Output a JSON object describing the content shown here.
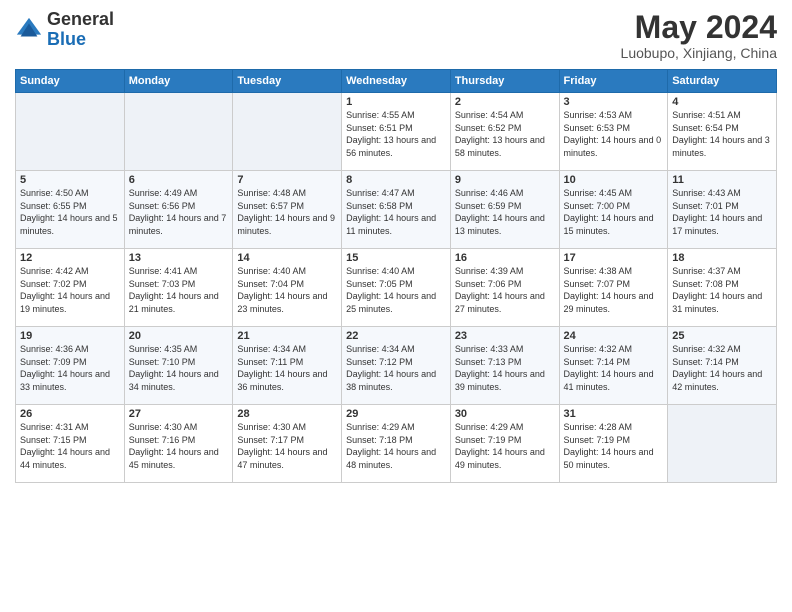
{
  "header": {
    "logo_line1": "General",
    "logo_line2": "Blue",
    "title": "May 2024",
    "subtitle": "Luobupo, Xinjiang, China"
  },
  "weekdays": [
    "Sunday",
    "Monday",
    "Tuesday",
    "Wednesday",
    "Thursday",
    "Friday",
    "Saturday"
  ],
  "weeks": [
    [
      {
        "day": "",
        "sunrise": "",
        "sunset": "",
        "daylight": ""
      },
      {
        "day": "",
        "sunrise": "",
        "sunset": "",
        "daylight": ""
      },
      {
        "day": "",
        "sunrise": "",
        "sunset": "",
        "daylight": ""
      },
      {
        "day": "1",
        "sunrise": "Sunrise: 4:55 AM",
        "sunset": "Sunset: 6:51 PM",
        "daylight": "Daylight: 13 hours and 56 minutes."
      },
      {
        "day": "2",
        "sunrise": "Sunrise: 4:54 AM",
        "sunset": "Sunset: 6:52 PM",
        "daylight": "Daylight: 13 hours and 58 minutes."
      },
      {
        "day": "3",
        "sunrise": "Sunrise: 4:53 AM",
        "sunset": "Sunset: 6:53 PM",
        "daylight": "Daylight: 14 hours and 0 minutes."
      },
      {
        "day": "4",
        "sunrise": "Sunrise: 4:51 AM",
        "sunset": "Sunset: 6:54 PM",
        "daylight": "Daylight: 14 hours and 3 minutes."
      }
    ],
    [
      {
        "day": "5",
        "sunrise": "Sunrise: 4:50 AM",
        "sunset": "Sunset: 6:55 PM",
        "daylight": "Daylight: 14 hours and 5 minutes."
      },
      {
        "day": "6",
        "sunrise": "Sunrise: 4:49 AM",
        "sunset": "Sunset: 6:56 PM",
        "daylight": "Daylight: 14 hours and 7 minutes."
      },
      {
        "day": "7",
        "sunrise": "Sunrise: 4:48 AM",
        "sunset": "Sunset: 6:57 PM",
        "daylight": "Daylight: 14 hours and 9 minutes."
      },
      {
        "day": "8",
        "sunrise": "Sunrise: 4:47 AM",
        "sunset": "Sunset: 6:58 PM",
        "daylight": "Daylight: 14 hours and 11 minutes."
      },
      {
        "day": "9",
        "sunrise": "Sunrise: 4:46 AM",
        "sunset": "Sunset: 6:59 PM",
        "daylight": "Daylight: 14 hours and 13 minutes."
      },
      {
        "day": "10",
        "sunrise": "Sunrise: 4:45 AM",
        "sunset": "Sunset: 7:00 PM",
        "daylight": "Daylight: 14 hours and 15 minutes."
      },
      {
        "day": "11",
        "sunrise": "Sunrise: 4:43 AM",
        "sunset": "Sunset: 7:01 PM",
        "daylight": "Daylight: 14 hours and 17 minutes."
      }
    ],
    [
      {
        "day": "12",
        "sunrise": "Sunrise: 4:42 AM",
        "sunset": "Sunset: 7:02 PM",
        "daylight": "Daylight: 14 hours and 19 minutes."
      },
      {
        "day": "13",
        "sunrise": "Sunrise: 4:41 AM",
        "sunset": "Sunset: 7:03 PM",
        "daylight": "Daylight: 14 hours and 21 minutes."
      },
      {
        "day": "14",
        "sunrise": "Sunrise: 4:40 AM",
        "sunset": "Sunset: 7:04 PM",
        "daylight": "Daylight: 14 hours and 23 minutes."
      },
      {
        "day": "15",
        "sunrise": "Sunrise: 4:40 AM",
        "sunset": "Sunset: 7:05 PM",
        "daylight": "Daylight: 14 hours and 25 minutes."
      },
      {
        "day": "16",
        "sunrise": "Sunrise: 4:39 AM",
        "sunset": "Sunset: 7:06 PM",
        "daylight": "Daylight: 14 hours and 27 minutes."
      },
      {
        "day": "17",
        "sunrise": "Sunrise: 4:38 AM",
        "sunset": "Sunset: 7:07 PM",
        "daylight": "Daylight: 14 hours and 29 minutes."
      },
      {
        "day": "18",
        "sunrise": "Sunrise: 4:37 AM",
        "sunset": "Sunset: 7:08 PM",
        "daylight": "Daylight: 14 hours and 31 minutes."
      }
    ],
    [
      {
        "day": "19",
        "sunrise": "Sunrise: 4:36 AM",
        "sunset": "Sunset: 7:09 PM",
        "daylight": "Daylight: 14 hours and 33 minutes."
      },
      {
        "day": "20",
        "sunrise": "Sunrise: 4:35 AM",
        "sunset": "Sunset: 7:10 PM",
        "daylight": "Daylight: 14 hours and 34 minutes."
      },
      {
        "day": "21",
        "sunrise": "Sunrise: 4:34 AM",
        "sunset": "Sunset: 7:11 PM",
        "daylight": "Daylight: 14 hours and 36 minutes."
      },
      {
        "day": "22",
        "sunrise": "Sunrise: 4:34 AM",
        "sunset": "Sunset: 7:12 PM",
        "daylight": "Daylight: 14 hours and 38 minutes."
      },
      {
        "day": "23",
        "sunrise": "Sunrise: 4:33 AM",
        "sunset": "Sunset: 7:13 PM",
        "daylight": "Daylight: 14 hours and 39 minutes."
      },
      {
        "day": "24",
        "sunrise": "Sunrise: 4:32 AM",
        "sunset": "Sunset: 7:14 PM",
        "daylight": "Daylight: 14 hours and 41 minutes."
      },
      {
        "day": "25",
        "sunrise": "Sunrise: 4:32 AM",
        "sunset": "Sunset: 7:14 PM",
        "daylight": "Daylight: 14 hours and 42 minutes."
      }
    ],
    [
      {
        "day": "26",
        "sunrise": "Sunrise: 4:31 AM",
        "sunset": "Sunset: 7:15 PM",
        "daylight": "Daylight: 14 hours and 44 minutes."
      },
      {
        "day": "27",
        "sunrise": "Sunrise: 4:30 AM",
        "sunset": "Sunset: 7:16 PM",
        "daylight": "Daylight: 14 hours and 45 minutes."
      },
      {
        "day": "28",
        "sunrise": "Sunrise: 4:30 AM",
        "sunset": "Sunset: 7:17 PM",
        "daylight": "Daylight: 14 hours and 47 minutes."
      },
      {
        "day": "29",
        "sunrise": "Sunrise: 4:29 AM",
        "sunset": "Sunset: 7:18 PM",
        "daylight": "Daylight: 14 hours and 48 minutes."
      },
      {
        "day": "30",
        "sunrise": "Sunrise: 4:29 AM",
        "sunset": "Sunset: 7:19 PM",
        "daylight": "Daylight: 14 hours and 49 minutes."
      },
      {
        "day": "31",
        "sunrise": "Sunrise: 4:28 AM",
        "sunset": "Sunset: 7:19 PM",
        "daylight": "Daylight: 14 hours and 50 minutes."
      },
      {
        "day": "",
        "sunrise": "",
        "sunset": "",
        "daylight": ""
      }
    ]
  ]
}
